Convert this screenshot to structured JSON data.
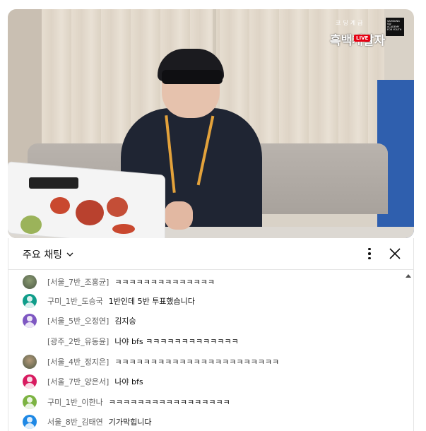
{
  "video": {
    "logo_small": "코딩계급",
    "logo_main": "흑백개발자",
    "logo_live": "LIVE",
    "logo_box_text": "SAMSUNG SW ACADEMY FOR YOUTH"
  },
  "chat": {
    "title": "주요 채팅",
    "messages": [
      {
        "author": "[서울_7반_조홍균]",
        "text": "ㅋㅋㅋㅋㅋㅋㅋㅋㅋㅋㅋㅋㅋㅋ",
        "avatar": "photo",
        "color": "#8a9a72"
      },
      {
        "author": "구미_1반_도승국",
        "text": "1반인데 5반 투표했습니다",
        "avatar": "default",
        "color": "#0f9d8a"
      },
      {
        "author": "[서울_5반_오정연]",
        "text": "김지승",
        "avatar": "default",
        "color": "#7e57c2"
      },
      {
        "author": "[광주_2반_유동윤]",
        "text": "나야 bfs ㅋㅋㅋㅋㅋㅋㅋㅋㅋㅋㅋㅋㅋ",
        "avatar": "none",
        "color": "#ffffff"
      },
      {
        "author": "[서울_4반_정지은]",
        "text": "ㅋㅋㅋㅋㅋㅋㅋㅋㅋㅋㅋㅋㅋㅋㅋㅋㅋㅋㅋㅋㅋㅋㅋ",
        "avatar": "photo",
        "color": "#b59a7a"
      },
      {
        "author": "[서울_7반_양은서]",
        "text": "나야 bfs",
        "avatar": "default",
        "color": "#d81b60"
      },
      {
        "author": "구미_1반_이한나",
        "text": "ㅋㅋㅋㅋㅋㅋㅋㅋㅋㅋㅋㅋㅋㅋㅋㅋㅋ",
        "avatar": "default",
        "color": "#7cb342"
      },
      {
        "author": "서울_8반_김태연",
        "text": "기가막힙니다",
        "avatar": "default",
        "color": "#1e88e5"
      }
    ]
  },
  "icons": {
    "chevron": "chevron-down-icon",
    "more": "more-vert-icon",
    "close": "close-icon",
    "scroll_up": "scroll-up-arrow-icon"
  }
}
